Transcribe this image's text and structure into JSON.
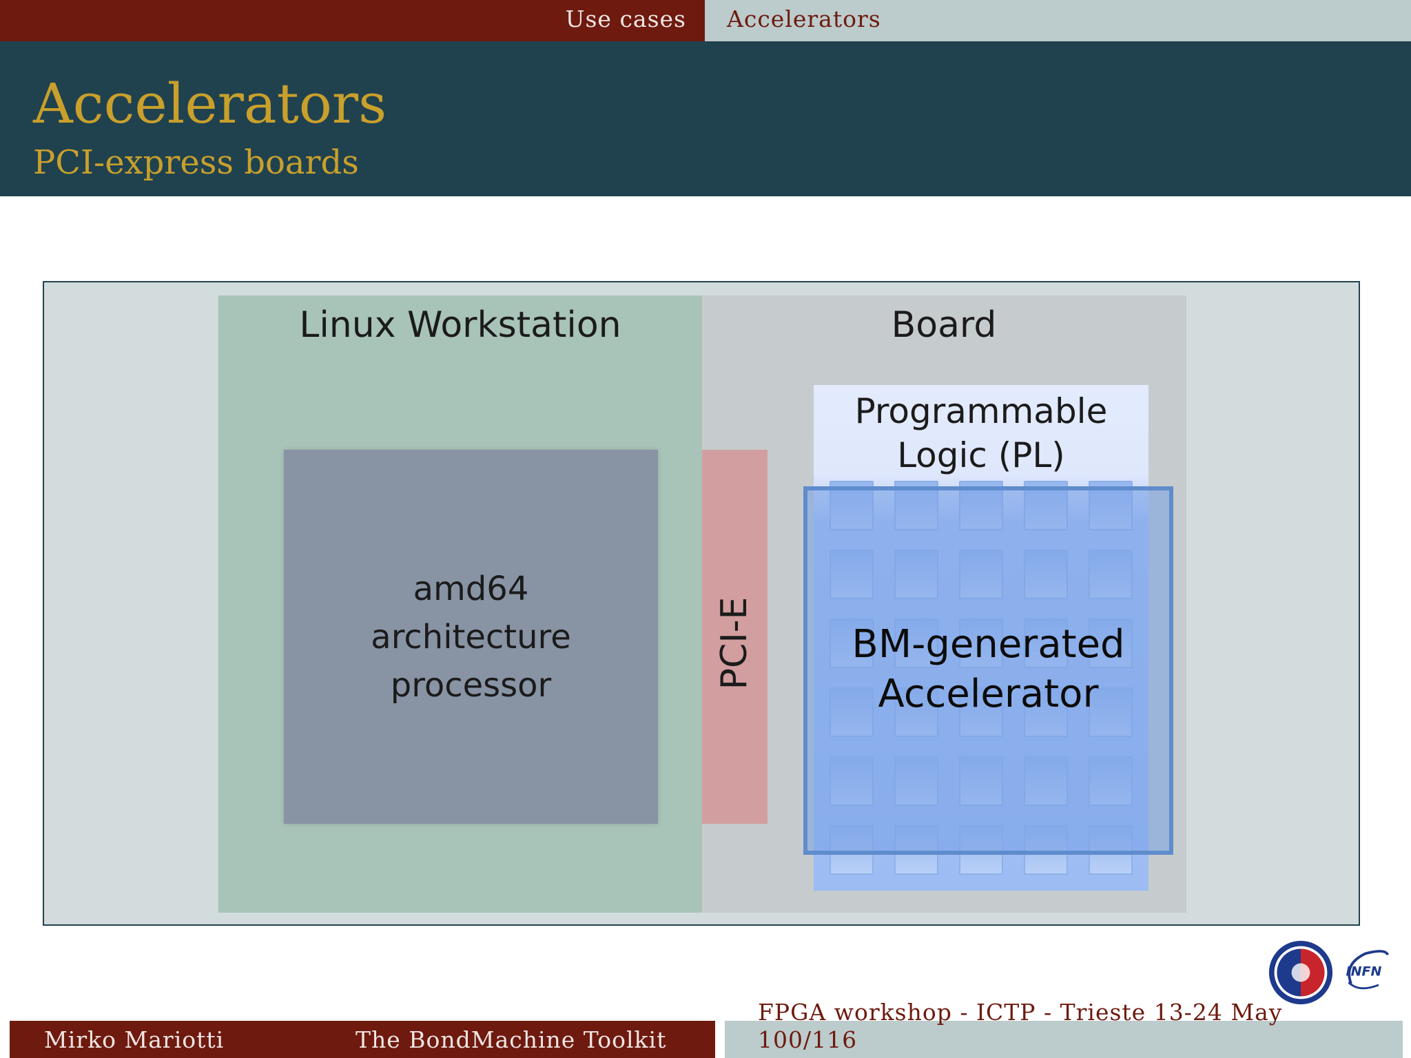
{
  "nav": {
    "section": "Use cases",
    "subsection": "Accelerators"
  },
  "header": {
    "title": "Accelerators",
    "subtitle": "PCI-express boards"
  },
  "diagram": {
    "workstation_label": "Linux Workstation",
    "board_label": "Board",
    "cpu_lines": [
      "amd64",
      "architecture",
      "processor"
    ],
    "pcie_label": "PCI-E",
    "pl_lines": [
      "Programmable",
      "Logic (PL)"
    ],
    "accelerator_lines": [
      "BM-generated",
      "Accelerator"
    ],
    "cell_grid": {
      "columns": 5,
      "rows": 6
    },
    "colors": {
      "workstation": "#a8c3b8",
      "board": "#c6cccd",
      "cpu": "#8893a4",
      "pcie": "#d29e9f",
      "accelerator_border": "#5f8ccc"
    }
  },
  "footer": {
    "author": "Mirko Mariotti",
    "talk_title": "The BondMachine Toolkit",
    "event": "FPGA workshop - ICTP - Trieste 13-24 May",
    "page": "100/116"
  },
  "logos": [
    "university-of-perugia-seal",
    "infn-logo"
  ],
  "theme": {
    "dark_red": "#6e1a0f",
    "teal": "#20424f",
    "gold": "#c9a02b",
    "light_gray": "#bccbcb"
  }
}
